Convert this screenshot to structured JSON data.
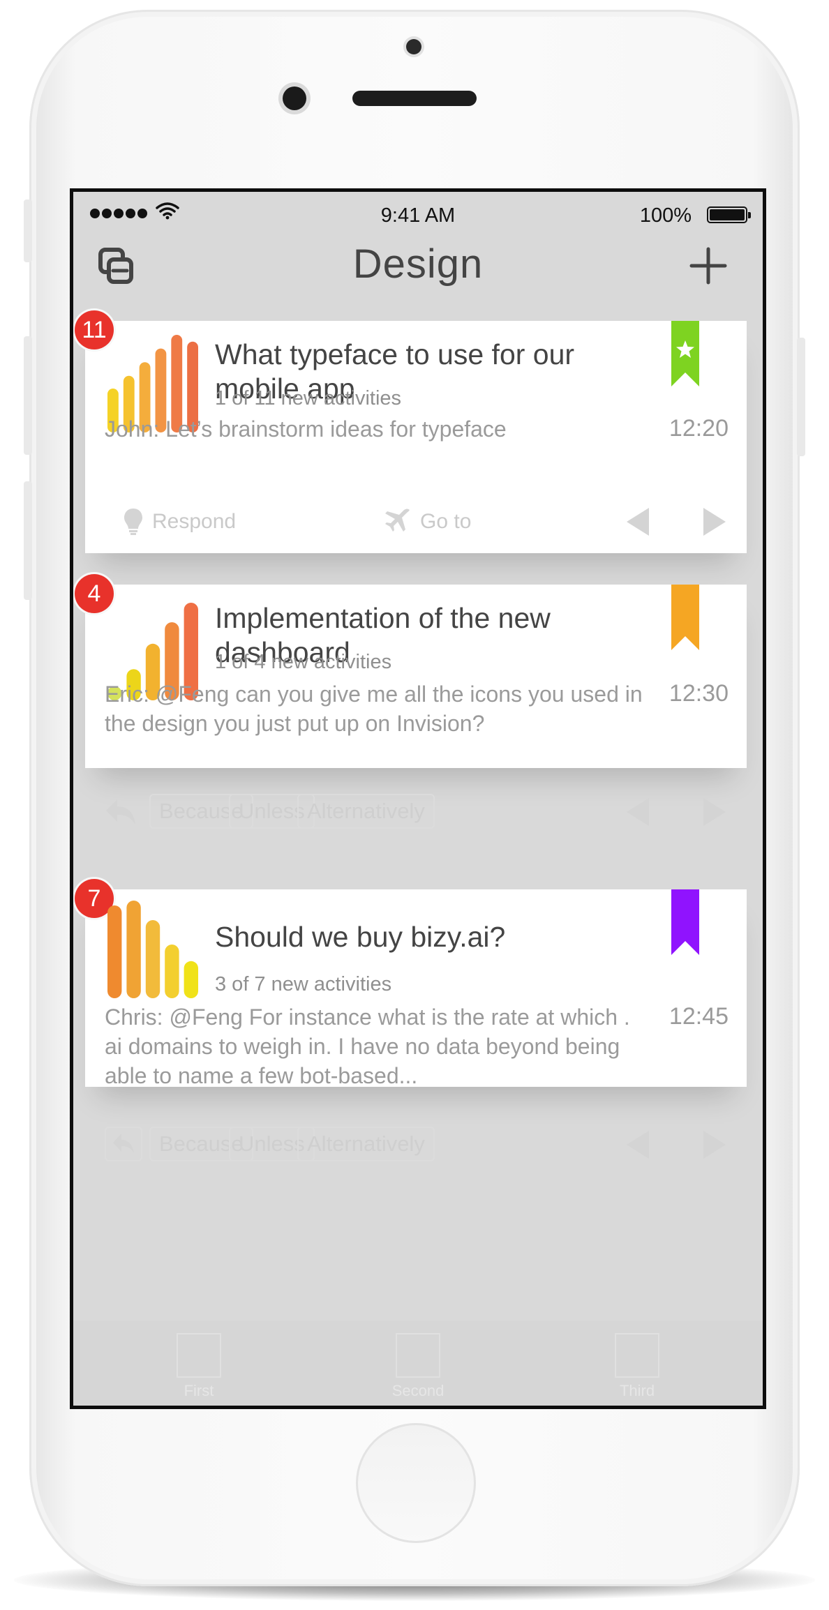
{
  "status_bar": {
    "time": "9:41 AM",
    "battery": "100%"
  },
  "nav": {
    "title": "Design",
    "left_icon": "layers-icon",
    "right_icon": "plus-icon"
  },
  "cards": [
    {
      "badge": "11",
      "title": "What typeface to use for our mobile app",
      "subtitle": "1 of 11 new activities",
      "message": "John: Let’s brainstorm ideas for typeface",
      "time": "12:20",
      "ribbon_color": "#7ed321",
      "ribbon_icon": "star-icon",
      "bar_levels": [
        0.45,
        0.58,
        0.72,
        0.86,
        1.0,
        0.93
      ],
      "bar_colors": [
        "#f5d226",
        "#f5c22e",
        "#f4ad3c",
        "#f29444",
        "#ef7a46",
        "#ec6f44"
      ],
      "actions": {
        "respond": "Respond",
        "goto": "Go to"
      }
    },
    {
      "badge": "4",
      "title": "Implementation of the new dashboard",
      "subtitle": "1 of 4 new activities",
      "message": "Eric: @Feng can you give me all the icons you used in the design you just put up on Invision?",
      "time": "12:30",
      "ribbon_color": "#f5a623",
      "bar_levels": [
        0.12,
        0.32,
        0.58,
        0.8,
        1.0
      ],
      "bar_colors": [
        "#d5e25c",
        "#ecd51a",
        "#f2b22f",
        "#f08a3e",
        "#ef6f44"
      ],
      "chips": [
        "Because",
        "Unless",
        "Alternatively"
      ]
    },
    {
      "badge": "7",
      "title": "Should we buy bizy.ai?",
      "subtitle": "3 of 7 new activities",
      "message": "Chris: @Feng For instance what is the rate at which . ai domains to weigh in. I have no data beyond being able to name a few bot-based...",
      "time": "12:45",
      "ribbon_color": "#9013fe",
      "bar_levels": [
        0.95,
        1.0,
        0.8,
        0.55,
        0.38
      ],
      "bar_colors": [
        "#ef8a2f",
        "#f0a334",
        "#f2bb3b",
        "#f3cf2f",
        "#f0e219"
      ],
      "chips": [
        "Because",
        "Unless",
        "Alternatively"
      ]
    }
  ],
  "tabs": [
    {
      "label": "First"
    },
    {
      "label": "Second"
    },
    {
      "label": "Third"
    }
  ]
}
